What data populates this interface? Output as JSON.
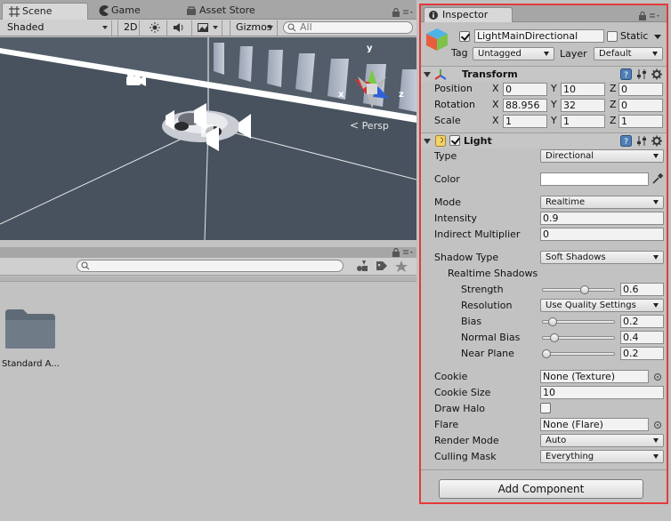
{
  "scene": {
    "tabs": [
      {
        "label": "Scene",
        "icon": "grid-icon"
      },
      {
        "label": "Game",
        "icon": "pacman-icon"
      },
      {
        "label": "Asset Store",
        "icon": "store-icon"
      }
    ],
    "toolbar": {
      "shading_mode": "Shaded",
      "mode_2d": "2D",
      "gizmos_label": "Gizmos",
      "search_placeholder": "All"
    },
    "gizmo_axes": {
      "x": "x",
      "y": "y",
      "z": "z"
    },
    "projection_label": "Persp"
  },
  "project": {
    "folders": [
      {
        "label": "Standard A..."
      }
    ]
  },
  "inspector": {
    "tab_label": "Inspector",
    "object": {
      "active": true,
      "name": "LightMainDirectional",
      "static_label": "Static",
      "static": false,
      "tag_label": "Tag",
      "tag": "Untagged",
      "layer_label": "Layer",
      "layer": "Default"
    },
    "transform": {
      "title": "Transform",
      "rows": [
        {
          "label": "Position",
          "x": "0",
          "y": "10",
          "z": "0"
        },
        {
          "label": "Rotation",
          "x": "88.956",
          "y": "32",
          "z": "0"
        },
        {
          "label": "Scale",
          "x": "1",
          "y": "1",
          "z": "1"
        }
      ],
      "axis_labels": {
        "x": "X",
        "y": "Y",
        "z": "Z"
      }
    },
    "light": {
      "title": "Light",
      "enabled": true,
      "type_label": "Type",
      "type": "Directional",
      "color_label": "Color",
      "color_value": "#ffffff",
      "mode_label": "Mode",
      "mode": "Realtime",
      "intensity_label": "Intensity",
      "intensity": "0.9",
      "indirect_label": "Indirect Multiplier",
      "indirect": "0",
      "shadow_type_label": "Shadow Type",
      "shadow_type": "Soft Shadows",
      "realtime_shadows_label": "Realtime Shadows",
      "strength_label": "Strength",
      "strength": "0.6",
      "strength_fraction": 0.6,
      "resolution_label": "Resolution",
      "resolution": "Use Quality Settings",
      "bias_label": "Bias",
      "bias": "0.2",
      "bias_fraction": 0.1,
      "normal_bias_label": "Normal Bias",
      "normal_bias": "0.4",
      "normal_bias_fraction": 0.13,
      "near_plane_label": "Near Plane",
      "near_plane": "0.2",
      "near_plane_fraction": 0.0,
      "cookie_label": "Cookie",
      "cookie": "None (Texture)",
      "cookie_size_label": "Cookie Size",
      "cookie_size": "10",
      "draw_halo_label": "Draw Halo",
      "draw_halo": false,
      "flare_label": "Flare",
      "flare": "None (Flare)",
      "render_mode_label": "Render Mode",
      "render_mode": "Auto",
      "culling_mask_label": "Culling Mask",
      "culling_mask": "Everything"
    },
    "add_component_label": "Add Component"
  },
  "colors": {
    "highlight_border": "#e43a3a",
    "viewport_bg": "#45505c",
    "gizmo_x": "#d63030",
    "gizmo_y": "#7ac943",
    "gizmo_z": "#2f62d8"
  }
}
